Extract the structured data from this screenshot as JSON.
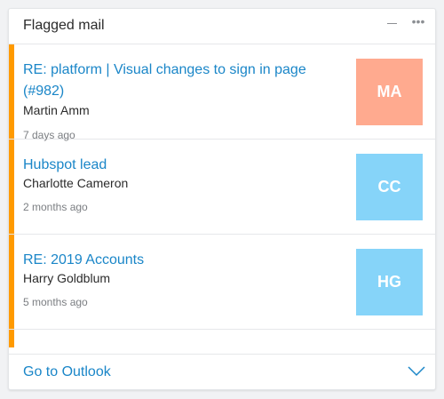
{
  "widget": {
    "title": "Flagged mail",
    "controls": {
      "minimize_icon": "minus-icon",
      "more_icon": "more-horizontal-icon",
      "more_label": "•••"
    },
    "accent_color": "#ff9a00",
    "link_color": "#1a86c8"
  },
  "mails": [
    {
      "subject": "RE: platform | Visual changes to sign in page (#982)",
      "sender": "Martin Amm",
      "time": "7 days ago",
      "initials": "MA",
      "avatar_color": "#ffaa8f"
    },
    {
      "subject": "Hubspot lead",
      "sender": "Charlotte Cameron",
      "time": "2 months ago",
      "initials": "CC",
      "avatar_color": "#86d4f9"
    },
    {
      "subject": "RE: 2019 Accounts",
      "sender": "Harry Goldblum",
      "time": "5 months ago",
      "initials": "HG",
      "avatar_color": "#86d4f9"
    }
  ],
  "footer": {
    "link_label": "Go to Outlook",
    "expand_icon": "chevron-down-icon"
  }
}
